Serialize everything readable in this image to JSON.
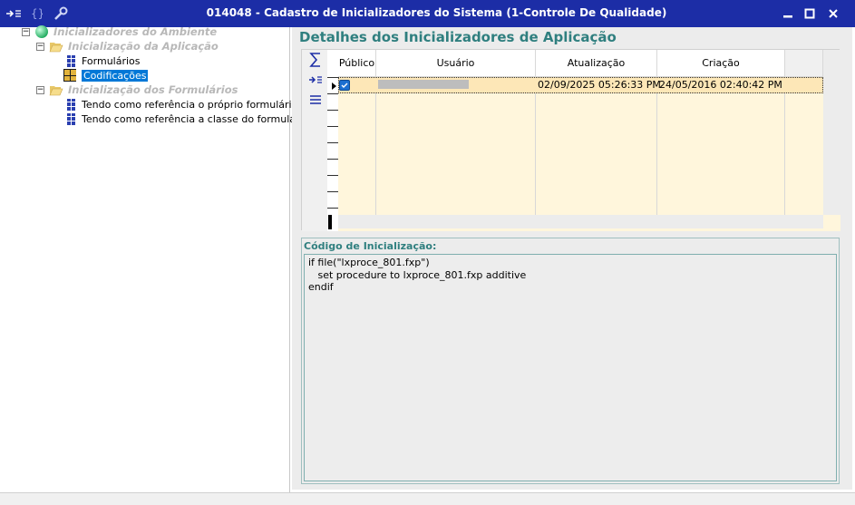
{
  "window": {
    "title": "014048 - Cadastro de Inicializadores do Sistema (1-Controle De Qualidade)",
    "controls": {
      "minimize": "minimize-icon",
      "maximize": "maximize-icon",
      "close": "close-icon"
    }
  },
  "tree": {
    "root": {
      "label": "Inicializadores do Ambiente",
      "expander": "−"
    },
    "app_group": {
      "label": "Inicialização da Aplicação",
      "expander": "−"
    },
    "app_items": [
      {
        "label": "Formulários"
      },
      {
        "label": "Codificações"
      }
    ],
    "forms_group": {
      "label": "Inicialização dos Formulários",
      "expander": "−"
    },
    "forms_items": [
      {
        "label": "Tendo como referência o próprio formulário"
      },
      {
        "label": "Tendo como referência a classe do formulário"
      }
    ]
  },
  "details": {
    "title": "Detalhes dos Inicializadores de Aplicação",
    "side_icons": [
      "sum-icon",
      "indent-icon",
      "menu-icon"
    ],
    "columns": [
      "Público",
      "Usuário",
      "Atualização",
      "Criação"
    ],
    "rows": [
      {
        "publico": "checked",
        "usuario": "",
        "atualizacao": "02/09/2025 05:26:33 PM",
        "criacao": "24/05/2016 02:40:42 PM"
      }
    ]
  },
  "code": {
    "label": "Código de Inicialização:",
    "lines": [
      "if file(\"lxproce_801.fxp\")",
      "   set procedure to lxproce_801.fxp additive",
      "endif"
    ]
  },
  "colors": {
    "titlebar": "#1c2da6",
    "accent_text": "#2f7f7f",
    "grid_bg": "#fff6dc",
    "selected_row": "#fde7b7",
    "tree_selected": "#0078d7"
  }
}
